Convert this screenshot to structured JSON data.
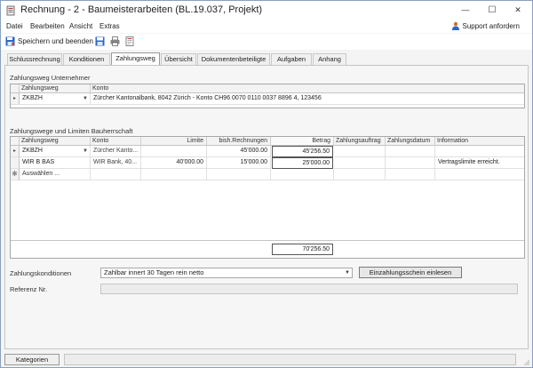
{
  "window": {
    "title": "Rechnung - 2 - Baumeisterarbeiten (BL.19.037, Projekt)",
    "minimize": "—",
    "maximize": "☐",
    "close": "✕"
  },
  "menu": {
    "items": [
      "Datei",
      "Bearbeiten",
      "Ansicht",
      "Extras"
    ],
    "support_label": "Support anfordern"
  },
  "toolbar": {
    "save_label": "Speichern und beenden"
  },
  "tabs": [
    {
      "label": "Schlussrechnung"
    },
    {
      "label": "Konditionen"
    },
    {
      "label": "Zahlungsweg",
      "active": true
    },
    {
      "label": "Übersicht"
    },
    {
      "label": "Dokumentenbeteiligte"
    },
    {
      "label": "Aufgaben"
    },
    {
      "label": "Anhang"
    }
  ],
  "unternehmer": {
    "section_label": "Zahlungsweg Unternehmer",
    "headers": {
      "zahlungsweg": "Zahlungsweg",
      "konto": "Konto"
    },
    "row": {
      "zahlungsweg": "ZKBZH",
      "konto": "Zürcher Kantonalbank, 8042 Zürich - Konto CH96 0070 0110 0037 8896 4, 123456"
    }
  },
  "bauherrschaft": {
    "section_label": "Zahlungswege und Limiten Bauherrschaft",
    "headers": {
      "zahlungsweg": "Zahlungsweg",
      "konto": "Konto",
      "limite": "Limite",
      "bisherige": "bish.Rechnungen",
      "betrag": "Betrag",
      "zahlungsauftrag": "Zahlungsauftrag",
      "zahlungsdatum": "Zahlungsdatum",
      "information": "Information"
    },
    "rows": [
      {
        "zahlungsweg": "ZKBZH",
        "konto": "Zürcher Kanto...",
        "limite": "",
        "bisherige": "45'000.00",
        "betrag": "45'256.50",
        "information": ""
      },
      {
        "zahlungsweg": "WIR B BAS",
        "konto": "WIR Bank, 40...",
        "limite": "40'000.00",
        "bisherige": "15'000.00",
        "betrag": "25'000.00",
        "information": "Vertragslimite erreicht."
      }
    ],
    "new_row_placeholder": "Auswählen ...",
    "total": "70'256.50"
  },
  "conditions": {
    "label": "Zahlungskonditionen",
    "value": "Zahlbar innert 30 Tagen rein netto",
    "einlesen_button": "Einzahlungsschein einlesen",
    "referenz_label": "Referenz Nr.",
    "referenz_value": ""
  },
  "footer": {
    "kategorien_button": "Kategorien"
  },
  "colors": {
    "accent": "#2e66c2",
    "window_border": "#8aa0c0"
  }
}
